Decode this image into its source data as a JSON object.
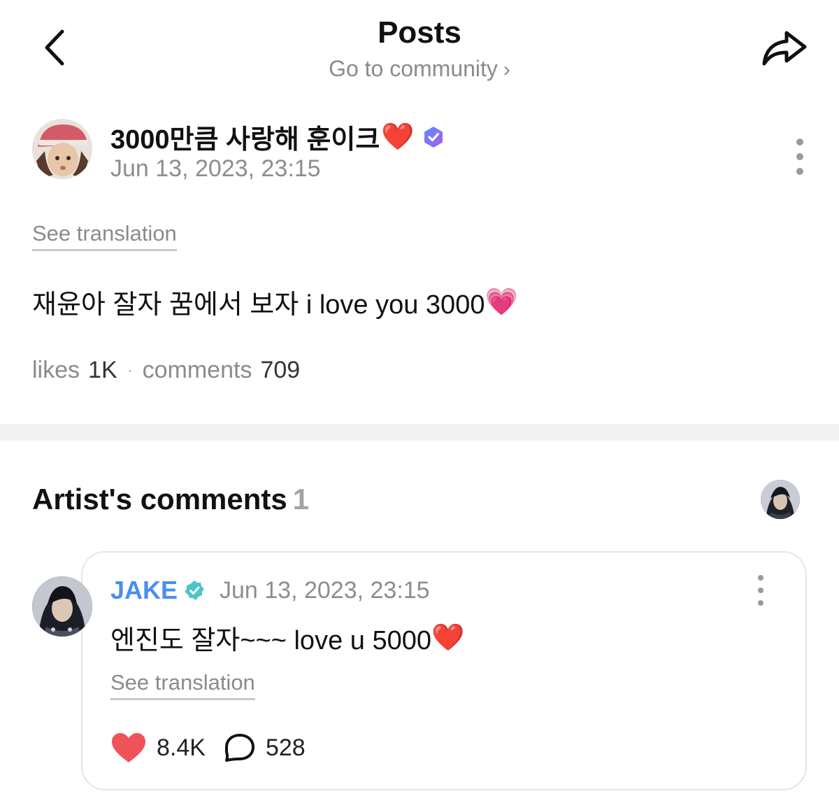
{
  "header": {
    "title": "Posts",
    "subtitle": "Go to community",
    "subtitle_chevron": "›",
    "back_icon": "chevron-left-icon",
    "share_icon": "share-arrow-icon"
  },
  "post": {
    "author_name": "3000만큼 사랑해 훈이크",
    "author_emoji": "❤️",
    "timestamp": "Jun 13, 2023, 23:15",
    "see_translation": "See translation",
    "body": "재윤아 잘자 꿈에서 보자 i love you 3000",
    "body_emoji": "💗",
    "likes_label": "likes",
    "likes_value": "1K",
    "stats_separator": "·",
    "comments_label": "comments",
    "comments_value": "709"
  },
  "artist_comments": {
    "heading": "Artist's comments",
    "count": "1",
    "comment": {
      "author": "JAKE",
      "timestamp": "Jun 13, 2023, 23:15",
      "text": "엔진도 잘자~~~ love u 5000",
      "text_emoji": "❤️",
      "see_translation": "See translation",
      "likes": "8.4K",
      "replies": "528"
    }
  },
  "colors": {
    "accent_blue": "#4a8ef0",
    "heart_red": "#f0525a",
    "muted_text": "#8b8b8b"
  }
}
